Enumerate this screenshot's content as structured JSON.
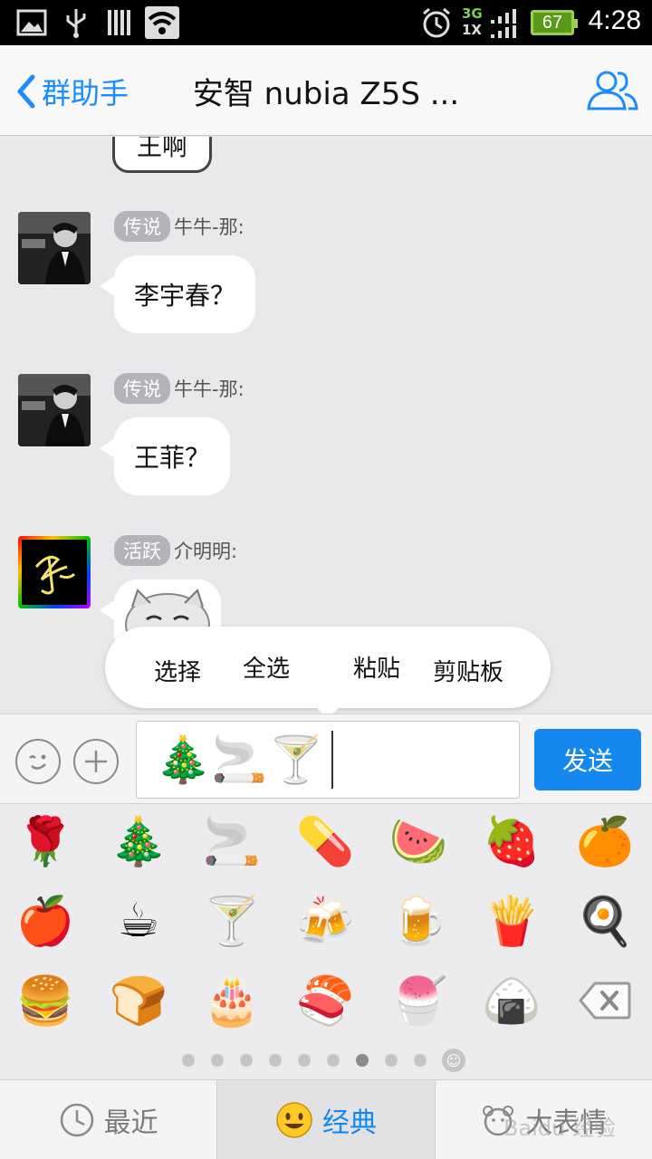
{
  "status_bar": {
    "network_top": "3G",
    "network_bottom": "1X",
    "battery": "67",
    "time": "4:28"
  },
  "header": {
    "back_label": "群助手",
    "title": "安智 nubia Z5S ..."
  },
  "messages": [
    {
      "badge": "传说",
      "sender": "牛牛-那:",
      "text": "李宇春？"
    },
    {
      "badge": "传说",
      "sender": "牛牛-那:",
      "text": "王菲？"
    },
    {
      "badge": "活跃",
      "sender": "介明明:",
      "text": ""
    }
  ],
  "partial_bubble_text": "王啊",
  "context_menu": {
    "items": [
      "选择",
      "全选",
      "粘贴",
      "剪贴板"
    ]
  },
  "input": {
    "content": "🎄🚬🍸",
    "send_label": "发送"
  },
  "emoji_grid": [
    "🌹",
    "🎄",
    "🚬",
    "💊",
    "🍉",
    "🍓",
    "🍊",
    "🍎",
    "☕",
    "🍸",
    "🍻",
    "🍺",
    "🍟",
    "🍳",
    "🍔",
    "🍞",
    "🎂",
    "🍣",
    "🍧",
    "🍙",
    "backspace"
  ],
  "page_indicator": {
    "count": 9,
    "active": 6
  },
  "tabs": [
    {
      "label": "最近",
      "icon": "clock-icon",
      "active": false
    },
    {
      "label": "经典",
      "icon": "smiley-icon",
      "active": true
    },
    {
      "label": "大表情",
      "icon": "bear-icon",
      "active": false
    }
  ],
  "watermark": "Baidu 经验",
  "colors": {
    "accent": "#1588f0",
    "chat_bg": "#e9e9eb",
    "badge_bg": "#b4b4b8"
  }
}
